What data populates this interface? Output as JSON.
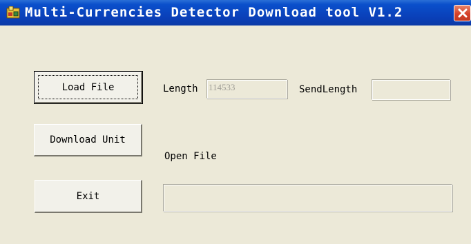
{
  "window": {
    "title": "Multi-Currencies Detector Download tool V1.2",
    "icon": "app-icon",
    "close_icon": "close-icon"
  },
  "buttons": {
    "load_file": "Load File",
    "download_unit": "Download Unit",
    "exit": "Exit"
  },
  "fields": {
    "length_label": "Length",
    "length_value": "114533",
    "send_length_label": "SendLength",
    "send_length_value": ""
  },
  "status": {
    "open_file_label": "Open File",
    "progress_value": ""
  },
  "colors": {
    "titlebar": "#0a3fb8",
    "window_bg": "#ece9d8",
    "close_button": "#d5412a"
  }
}
